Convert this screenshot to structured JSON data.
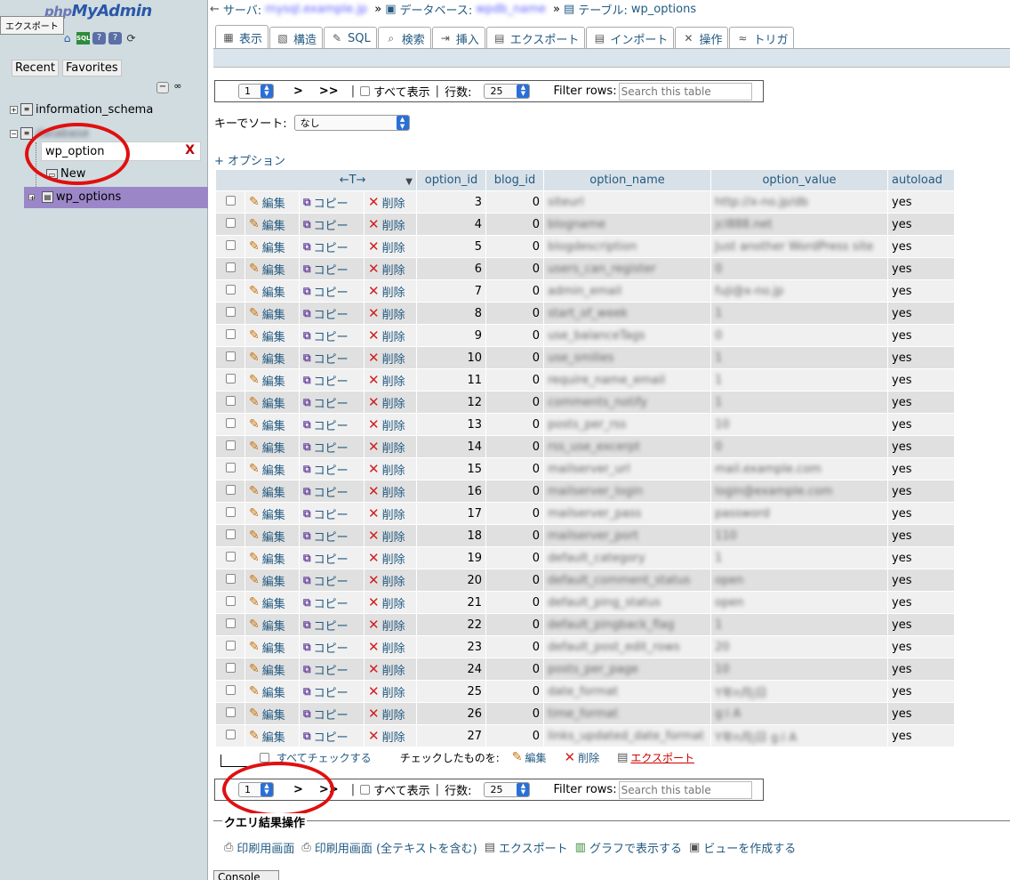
{
  "nav": {
    "logo_php": "php",
    "logo_myadmin": "MyAdmin",
    "tooltip": "エクスポート",
    "recent_tab": "Recent",
    "favorites_tab": "Favorites",
    "tree": {
      "info_schema": "information_schema",
      "filter_value": "wp_option",
      "filter_clear": "X",
      "new_label": "New",
      "table_label": "wp_options",
      "db_blurred": "database"
    }
  },
  "breadcrumb": {
    "server_label": "サーバ:",
    "server_value": "mysql.example.jp",
    "database_label": "データベース:",
    "database_value": "wpdb_name",
    "table_label": "テーブル:",
    "table_value": "wp_options",
    "separator": "»"
  },
  "tabs": [
    {
      "label": "表示",
      "icon": "browse-icon"
    },
    {
      "label": "構造",
      "icon": "structure-icon"
    },
    {
      "label": "SQL",
      "icon": "sql-icon"
    },
    {
      "label": "検索",
      "icon": "search-icon"
    },
    {
      "label": "挿入",
      "icon": "insert-icon"
    },
    {
      "label": "エクスポート",
      "icon": "export-icon"
    },
    {
      "label": "インポート",
      "icon": "import-icon"
    },
    {
      "label": "操作",
      "icon": "operations-icon"
    },
    {
      "label": "トリガ",
      "icon": "triggers-icon"
    }
  ],
  "navigation": {
    "page_value": "1",
    "next": ">",
    "last": ">>",
    "pipe": "|",
    "show_all": "すべて表示",
    "rows_label": "行数:",
    "rows_value": "25",
    "filter_label": "Filter rows:",
    "filter_placeholder": "Search this table"
  },
  "sort": {
    "label": "キーでソート:",
    "value": "なし"
  },
  "options_link": "+ オプション",
  "table": {
    "sort_arrows": "←T→",
    "columns": [
      "option_id",
      "blog_id",
      "option_name",
      "option_value",
      "autoload"
    ],
    "edit_label": "編集",
    "copy_label": "コピー",
    "delete_label": "削除",
    "rows": [
      {
        "id": "3",
        "blog": "0",
        "name": "siteurl",
        "value": "http://x-no.jp/db",
        "auto": "yes"
      },
      {
        "id": "4",
        "blog": "0",
        "name": "blogname",
        "value": "jcl888.net",
        "auto": "yes"
      },
      {
        "id": "5",
        "blog": "0",
        "name": "blogdescription",
        "value": "Just another WordPress site",
        "auto": "yes"
      },
      {
        "id": "6",
        "blog": "0",
        "name": "users_can_register",
        "value": "0",
        "auto": "yes"
      },
      {
        "id": "7",
        "blog": "0",
        "name": "admin_email",
        "value": "fuji@x-no.jp",
        "auto": "yes"
      },
      {
        "id": "8",
        "blog": "0",
        "name": "start_of_week",
        "value": "1",
        "auto": "yes"
      },
      {
        "id": "9",
        "blog": "0",
        "name": "use_balanceTags",
        "value": "0",
        "auto": "yes"
      },
      {
        "id": "10",
        "blog": "0",
        "name": "use_smilies",
        "value": "1",
        "auto": "yes"
      },
      {
        "id": "11",
        "blog": "0",
        "name": "require_name_email",
        "value": "1",
        "auto": "yes"
      },
      {
        "id": "12",
        "blog": "0",
        "name": "comments_notify",
        "value": "1",
        "auto": "yes"
      },
      {
        "id": "13",
        "blog": "0",
        "name": "posts_per_rss",
        "value": "10",
        "auto": "yes"
      },
      {
        "id": "14",
        "blog": "0",
        "name": "rss_use_excerpt",
        "value": "0",
        "auto": "yes"
      },
      {
        "id": "15",
        "blog": "0",
        "name": "mailserver_url",
        "value": "mail.example.com",
        "auto": "yes"
      },
      {
        "id": "16",
        "blog": "0",
        "name": "mailserver_login",
        "value": "login@example.com",
        "auto": "yes"
      },
      {
        "id": "17",
        "blog": "0",
        "name": "mailserver_pass",
        "value": "password",
        "auto": "yes"
      },
      {
        "id": "18",
        "blog": "0",
        "name": "mailserver_port",
        "value": "110",
        "auto": "yes"
      },
      {
        "id": "19",
        "blog": "0",
        "name": "default_category",
        "value": "1",
        "auto": "yes"
      },
      {
        "id": "20",
        "blog": "0",
        "name": "default_comment_status",
        "value": "open",
        "auto": "yes"
      },
      {
        "id": "21",
        "blog": "0",
        "name": "default_ping_status",
        "value": "open",
        "auto": "yes"
      },
      {
        "id": "22",
        "blog": "0",
        "name": "default_pingback_flag",
        "value": "1",
        "auto": "yes"
      },
      {
        "id": "23",
        "blog": "0",
        "name": "default_post_edit_rows",
        "value": "20",
        "auto": "yes"
      },
      {
        "id": "24",
        "blog": "0",
        "name": "posts_per_page",
        "value": "10",
        "auto": "yes"
      },
      {
        "id": "25",
        "blog": "0",
        "name": "date_format",
        "value": "Y年n月j日",
        "auto": "yes"
      },
      {
        "id": "26",
        "blog": "0",
        "name": "time_format",
        "value": "g:i A",
        "auto": "yes"
      },
      {
        "id": "27",
        "blog": "0",
        "name": "links_updated_date_format",
        "value": "Y年n月j日 g:i A",
        "auto": "yes"
      }
    ]
  },
  "bulk": {
    "check_all": "すべてチェックする",
    "with_selected": "チェックしたものを:",
    "edit": "編集",
    "delete": "削除",
    "export": "エクスポート"
  },
  "query_ops": {
    "legend": "クエリ結果操作",
    "links": [
      {
        "label": "印刷用画面",
        "icon": "print-icon"
      },
      {
        "label": "印刷用画面 (全テキストを含む)",
        "icon": "print-full-icon"
      },
      {
        "label": "エクスポート",
        "icon": "export-icon"
      },
      {
        "label": "グラフで表示する",
        "icon": "chart-icon"
      },
      {
        "label": "ビューを作成する",
        "icon": "view-icon"
      }
    ]
  },
  "console_label": "Console",
  "colors": {
    "link": "#235a81",
    "selected_table_bg": "#9b86c8",
    "annotation_red": "#e01010",
    "nav_bg": "#d0dce0"
  }
}
